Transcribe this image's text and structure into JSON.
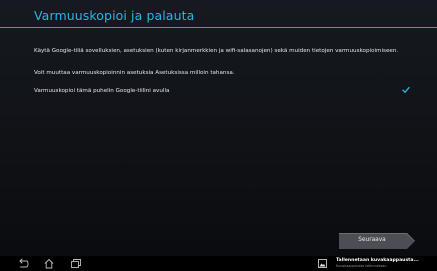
{
  "header": {
    "title": "Varmuuskopioi ja palauta"
  },
  "content": {
    "description": "Käytä Google-tiliä sovelluksien, asetuksien (kuten kirjanmerkkien ja wifi-salasanojen) sekä muiden tietojen varmuuskopioimiseen.",
    "settings_info": "Voit muuttaa varmuuskopioinnin asetuksia Asetuksissa milloin tahansa.",
    "backup_checkbox_label": "Varmuuskopioi tämä puhelin Google-tiilini avulla",
    "backup_checked": true
  },
  "footer": {
    "next_label": "Seuraava"
  },
  "system_bar": {
    "icons": [
      "back-icon",
      "home-icon",
      "recent-apps-icon"
    ],
    "notification_icon": "image-icon",
    "notification_title": "Tallennetaan kuvakaappausta...",
    "notification_subtitle": "Kuvakaappausta tallennetaan."
  },
  "colors": {
    "accent": "#2ab4e6",
    "text": "#e4e7ea",
    "background": "#111318",
    "nav_bar": "#000000"
  }
}
